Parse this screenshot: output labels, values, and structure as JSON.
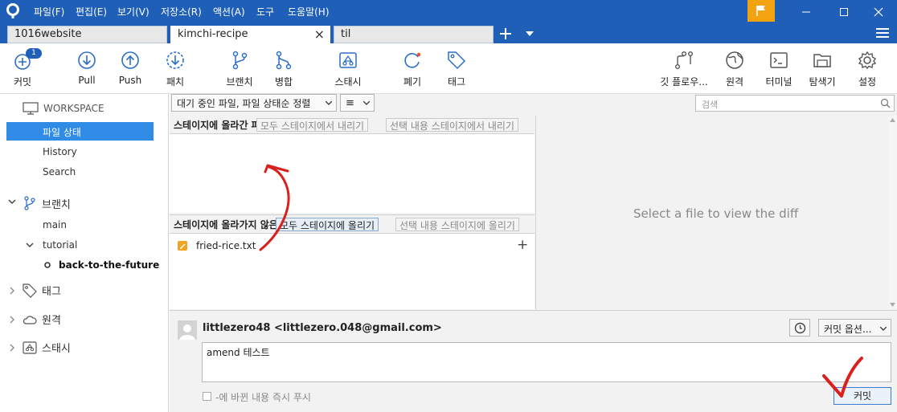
{
  "titlebar": {
    "menus": [
      "파일(F)",
      "편집(E)",
      "보기(V)",
      "저장소(R)",
      "액션(A)",
      "도구",
      "도움말(H)"
    ]
  },
  "tabs": [
    {
      "label": "1016website"
    },
    {
      "label": "kimchi-recipe",
      "close": "×"
    },
    {
      "label": "til"
    }
  ],
  "toolbar": {
    "commit": "커밋",
    "commit_badge": "1",
    "pull": "Pull",
    "push": "Push",
    "patch": "패치",
    "branch": "브랜치",
    "merge": "병합",
    "stash": "스태시",
    "discard": "폐기",
    "tag": "태그",
    "gitflow": "깃 플로우...",
    "remote": "원격",
    "terminal": "터미널",
    "explorer": "탐색기",
    "settings": "설정"
  },
  "sidebar": {
    "workspace": "WORKSPACE",
    "file_status": "파일 상태",
    "history": "History",
    "search": "Search",
    "branches": "브랜치",
    "main": "main",
    "tutorial": "tutorial",
    "back_to_the_future": "back-to-the-future",
    "tags": "태그",
    "remotes": "원격",
    "stashes": "스태시"
  },
  "filters": {
    "sort": "대기 중인 파일, 파일 상태순 정렬",
    "view": "≡",
    "search_placeholder": "검색"
  },
  "staged": {
    "header": "스테이지에 올라간 파일",
    "unstage_all": "모두 스테이지에서 내리기",
    "unstage_sel": "선택 내용 스테이지에서 내리기"
  },
  "unstaged": {
    "header": "스테이지에 올라가지 않은 파일",
    "stage_all": "모두 스테이지에 올리기",
    "stage_sel": "선택 내용 스테이지에 올리기",
    "files": [
      {
        "name": "fried-rice.txt",
        "add": "+"
      }
    ]
  },
  "diff": {
    "placeholder": "Select a file to view the diff"
  },
  "commit": {
    "author": "littlezero48 <littlezero.048@gmail.com>",
    "options": "커밋 옵션...",
    "message": "amend 테스트",
    "push_immediately": "-에 바뀐 내용 즉시 푸시",
    "button": "커밋"
  },
  "colors": {
    "accent": "#1f5fb8",
    "selected": "#2f8be6",
    "flag": "#f2a30f",
    "annotation": "#d9201c"
  }
}
